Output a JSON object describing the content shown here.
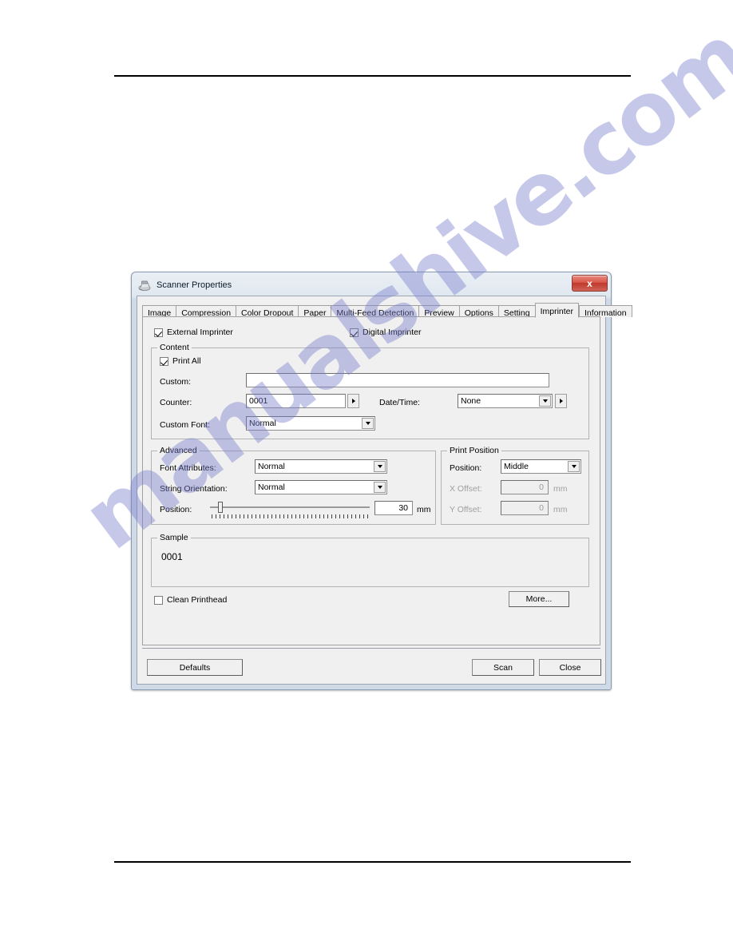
{
  "document": {
    "watermark": "manualshive.com"
  },
  "window": {
    "title": "Scanner Properties",
    "icon": "scanner-icon",
    "close_label": "x"
  },
  "tabs": [
    {
      "label": "Image",
      "active": false
    },
    {
      "label": "Compression",
      "active": false
    },
    {
      "label": "Color Dropout",
      "active": false
    },
    {
      "label": "Paper",
      "active": false
    },
    {
      "label": "Multi-Feed Detection",
      "active": false
    },
    {
      "label": "Preview",
      "active": false
    },
    {
      "label": "Options",
      "active": false
    },
    {
      "label": "Setting",
      "active": false
    },
    {
      "label": "Imprinter",
      "active": true
    },
    {
      "label": "Information",
      "active": false
    }
  ],
  "imprinter": {
    "external_imprinter": {
      "label": "External Imprinter",
      "checked": true
    },
    "digital_imprinter": {
      "label": "Digital Imprinter",
      "checked": true
    },
    "content": {
      "group_label": "Content",
      "print_all": {
        "label": "Print All",
        "checked": true
      },
      "custom_label": "Custom:",
      "custom_value": "",
      "custom_placeholder": "",
      "counter_label": "Counter:",
      "counter_value": "0001",
      "datetime_label": "Date/Time:",
      "datetime_value": "None",
      "custom_font_label": "Custom Font:",
      "custom_font_value": "Normal"
    },
    "advanced": {
      "group_label": "Advanced",
      "font_attributes_label": "Font Attributes:",
      "font_attributes_value": "Normal",
      "string_orientation_label": "String Orientation:",
      "string_orientation_value": "Normal",
      "position_label": "Position:",
      "position_value": "30",
      "position_unit": "mm",
      "position_slider_percent": 5,
      "tick_count": 40
    },
    "print_position": {
      "group_label": "Print Position",
      "position_label": "Position:",
      "position_value": "Middle",
      "x_offset_label": "X Offset:",
      "x_offset_value": "0",
      "x_offset_unit": "mm",
      "y_offset_label": "Y Offset:",
      "y_offset_value": "0",
      "y_offset_unit": "mm"
    },
    "sample": {
      "group_label": "Sample",
      "value": "0001"
    },
    "clean_printhead": {
      "label": "Clean Printhead",
      "checked": false
    },
    "more_label": "More..."
  },
  "footer": {
    "defaults_label": "Defaults",
    "scan_label": "Scan",
    "close_label": "Close"
  }
}
